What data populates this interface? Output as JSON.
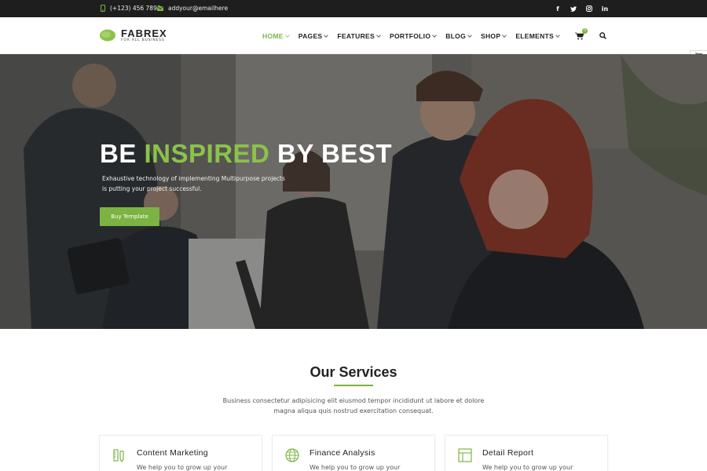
{
  "topbar": {
    "phone": "(+123) 456 7890",
    "email": "addyour@emailhere",
    "social": [
      "facebook-icon",
      "twitter-icon",
      "instagram-icon",
      "linkedin-icon"
    ]
  },
  "header": {
    "logo_name": "FABREX",
    "logo_tagline": "FOR ALL BUSINESS",
    "nav": [
      "HOME",
      "PAGES",
      "FEATURES",
      "PORTFOLIO",
      "BLOG",
      "SHOP",
      "ELEMENTS"
    ],
    "cart_count": "0"
  },
  "hero": {
    "title_part1": "BE ",
    "title_highlight": "INSPIRED",
    "title_part2": " BY BEST",
    "description": "Exhaustive technology of implementing Multipurpose projects is putting your project successful.",
    "button": "Buy Template"
  },
  "services": {
    "title": "Our Services",
    "description": "Business consectetur adipisicing elit eiusmod tempor incididunt ut labore et dolore magna aliqua quis nostrud exercitation consequat.",
    "cards": [
      {
        "title": "Content Marketing",
        "text": "We help you to grow up your",
        "icon": "pencil-ruler-icon"
      },
      {
        "title": "Finance Analysis",
        "text": "We help you to grow up your",
        "icon": "globe-icon"
      },
      {
        "title": "Detail Report",
        "text": "We help you to grow up your",
        "icon": "layout-icon"
      }
    ]
  },
  "colors": {
    "accent": "#7cb342",
    "topbar_bg": "#1e1e1e"
  }
}
